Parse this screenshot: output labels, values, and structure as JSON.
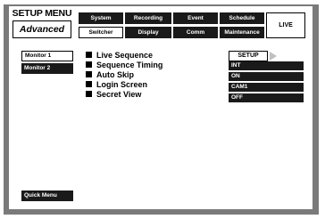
{
  "header": {
    "title": "SETUP MENU",
    "subtitle": "Advanced",
    "tabs_top": [
      "System",
      "Recording",
      "Event",
      "Schedule"
    ],
    "tabs_bottom": [
      "Switcher",
      "Display",
      "Comm",
      "Maintenance"
    ],
    "live_label": "LIVE"
  },
  "sidebar": {
    "items": [
      "Monitor 1",
      "Monitor 2"
    ],
    "quick_menu": "Quick Menu"
  },
  "settings": {
    "setup_button": "SETUP",
    "rows": [
      {
        "label": "Live Sequence",
        "value": ""
      },
      {
        "label": "Sequence Timing",
        "value": "INT"
      },
      {
        "label": "Auto Skip",
        "value": "ON"
      },
      {
        "label": "Login Screen",
        "value": "CAM1"
      },
      {
        "label": "Secret View",
        "value": "OFF"
      }
    ]
  },
  "colors": {
    "frame": "#7a7a7a",
    "dark": "#1a1a1a",
    "arrow": "#c0c0c0"
  }
}
